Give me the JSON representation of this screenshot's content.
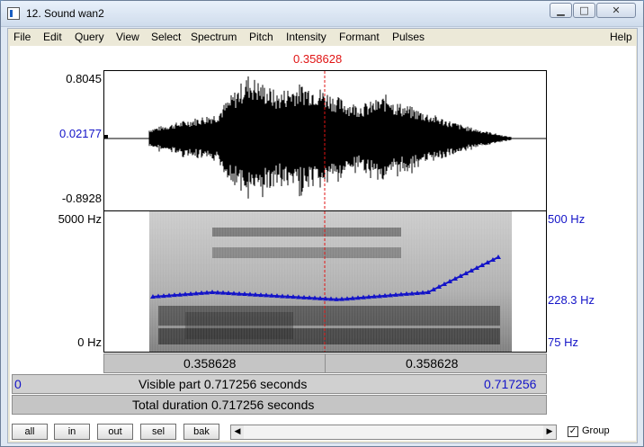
{
  "window": {
    "title": "12. Sound wan2",
    "min_icon": "minimize-icon",
    "max_icon": "maximize-icon",
    "close_icon": "close-icon"
  },
  "menu": [
    "File",
    "Edit",
    "Query",
    "View",
    "Select",
    "Spectrum",
    "Pitch",
    "Intensity",
    "Formant",
    "Pulses",
    "Help"
  ],
  "cursor": {
    "time": "0.358628"
  },
  "waveform": {
    "max_label": "0.8045",
    "zero_label": "0.02177",
    "min_label": "-0.8928"
  },
  "spectrogram": {
    "top_freq_label": "5000 Hz",
    "bottom_freq_label": "0 Hz",
    "pitch_top_label": "500 Hz",
    "pitch_mid_label": "228.3 Hz",
    "pitch_bottom_label": "75 Hz"
  },
  "time_bar": {
    "left_label": "0.358628",
    "right_label": "0.358628"
  },
  "visible_bar": {
    "start": "0",
    "text": "Visible part 0.717256 seconds",
    "end": "0.717256"
  },
  "total_bar": {
    "text": "Total duration 0.717256 seconds"
  },
  "buttons": {
    "all": "all",
    "in": "in",
    "out": "out",
    "sel": "sel",
    "bak": "bak"
  },
  "group": {
    "label": "Group",
    "checked": "✓"
  },
  "colors": {
    "cursor": "#e01414",
    "pitch": "#1414c8"
  }
}
